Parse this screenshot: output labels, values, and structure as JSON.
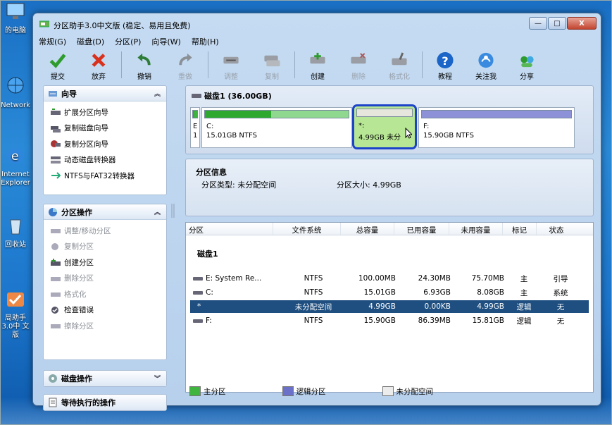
{
  "desktop": {
    "icons": [
      {
        "label": "的电脑"
      },
      {
        "label": "Network"
      },
      {
        "label": "Internet Explorer"
      },
      {
        "label": "回收站"
      },
      {
        "label": "局助手3.0中 文版"
      }
    ]
  },
  "window": {
    "title": "分区助手3.0中文版 (稳定、易用且免费)",
    "controls": {
      "minimize": "—",
      "maximize": "□",
      "close": "X"
    }
  },
  "menu": [
    "常规(G)",
    "磁盘(D)",
    "分区(P)",
    "向导(W)",
    "帮助(H)"
  ],
  "toolbar": {
    "items": [
      {
        "label": "提交",
        "icon": "check-icon",
        "enabled": true
      },
      {
        "label": "放弃",
        "icon": "x-icon",
        "enabled": true
      },
      {
        "label": "撤销",
        "icon": "undo-icon",
        "enabled": true
      },
      {
        "label": "重做",
        "icon": "redo-icon",
        "enabled": false
      },
      {
        "label": "调整",
        "icon": "resize-disk-icon",
        "enabled": false
      },
      {
        "label": "复制",
        "icon": "copy-disk-icon",
        "enabled": false
      },
      {
        "label": "创建",
        "icon": "create-disk-icon",
        "enabled": true
      },
      {
        "label": "删除",
        "icon": "delete-disk-icon",
        "enabled": false
      },
      {
        "label": "格式化",
        "icon": "format-disk-icon",
        "enabled": false
      },
      {
        "label": "教程",
        "icon": "help-icon",
        "enabled": true
      },
      {
        "label": "关注我",
        "icon": "follow-icon",
        "enabled": true
      },
      {
        "label": "分享",
        "icon": "share-icon",
        "enabled": true
      }
    ]
  },
  "sidebar": {
    "wizard": {
      "title": "向导",
      "items": [
        {
          "label": "扩展分区向导",
          "enabled": true
        },
        {
          "label": "复制磁盘向导",
          "enabled": true
        },
        {
          "label": "复制分区向导",
          "enabled": true
        },
        {
          "label": "动态磁盘转换器",
          "enabled": true
        },
        {
          "label": "NTFS与FAT32转换器",
          "enabled": true
        }
      ]
    },
    "partition_ops": {
      "title": "分区操作",
      "items": [
        {
          "label": "调整/移动分区",
          "enabled": false
        },
        {
          "label": "复制分区",
          "enabled": false
        },
        {
          "label": "创建分区",
          "enabled": true
        },
        {
          "label": "删除分区",
          "enabled": false
        },
        {
          "label": "格式化",
          "enabled": false
        },
        {
          "label": "检查错误",
          "enabled": true
        },
        {
          "label": "擦除分区",
          "enabled": false
        }
      ]
    },
    "disk_ops": {
      "title": "磁盘操作"
    },
    "pending_ops": {
      "title": "等待执行的操作"
    }
  },
  "disk_map": {
    "title": "磁盘1 (36.00GB)",
    "segments": [
      {
        "name": "E",
        "info": "1",
        "fill": 0.25,
        "color": "#2ea82e"
      },
      {
        "name": "C:",
        "info": "15.01GB NTFS",
        "fill": 0.46,
        "color": "#2ea82e"
      },
      {
        "name": "*:",
        "info": "4.99GB 未分",
        "fill": 0.0,
        "color": "#e6e6dc"
      },
      {
        "name": "F:",
        "info": "15.90GB NTFS",
        "fill": 0.0,
        "color": "#8c91d8"
      }
    ]
  },
  "partition_info": {
    "heading": "分区信息",
    "type_text": "分区类型: 未分配空间",
    "size_text": "分区大小: 4.99GB"
  },
  "table": {
    "headers": [
      "分区",
      "文件系统",
      "总容量",
      "已用容量",
      "未用容量",
      "标记",
      "状态"
    ],
    "group": "磁盘1",
    "rows": [
      {
        "name": "E:  System Re...",
        "fs": "NTFS",
        "total": "100.00MB",
        "used": "24.30MB",
        "free": "75.70MB",
        "flag": "主",
        "status": "引导",
        "selected": false
      },
      {
        "name": "C:",
        "fs": "NTFS",
        "total": "15.01GB",
        "used": "6.93GB",
        "free": "8.08GB",
        "flag": "主",
        "status": "系统",
        "selected": false
      },
      {
        "name": "*",
        "fs": "未分配空间",
        "total": "4.99GB",
        "used": "0.00KB",
        "free": "4.99GB",
        "flag": "逻辑",
        "status": "无",
        "selected": true
      },
      {
        "name": "F:",
        "fs": "NTFS",
        "total": "15.90GB",
        "used": "86.39MB",
        "free": "15.81GB",
        "flag": "逻辑",
        "status": "无",
        "selected": false
      }
    ]
  },
  "legend": [
    {
      "label": "主分区",
      "color": "#3fb53f"
    },
    {
      "label": "逻辑分区",
      "color": "#6b70c8"
    },
    {
      "label": "未分配空间",
      "color": "#ececec"
    }
  ]
}
